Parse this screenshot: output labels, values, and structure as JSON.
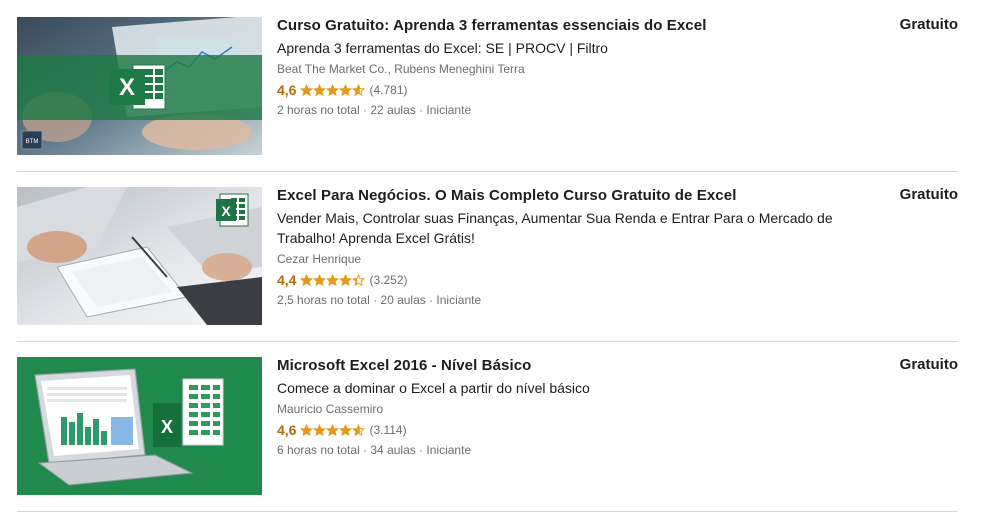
{
  "courses": [
    {
      "title": "Curso Gratuito: Aprenda 3 ferramentas essenciais do Excel",
      "headline": "Aprenda 3 ferramentas do Excel: SE | PROCV | Filtro",
      "instructor": "Beat The Market Co., Rubens Meneghini Terra",
      "rating": "4,6",
      "stars": 4.6,
      "rating_count": "(4.781)",
      "meta": "2 horas no total · 22 aulas · Iniciante",
      "price": "Gratuito",
      "thumb_badge": "BTM"
    },
    {
      "title": "Excel Para Negócios. O Mais Completo Curso Gratuito de Excel",
      "headline": "Vender Mais, Controlar suas Finanças, Aumentar Sua Renda e Entrar Para o Mercado de Trabalho! Aprenda Excel Grátis!",
      "instructor": "Cezar Henrique",
      "rating": "4,4",
      "stars": 4.4,
      "rating_count": "(3.252)",
      "meta": "2,5 horas no total · 20 aulas · Iniciante",
      "price": "Gratuito"
    },
    {
      "title": "Microsoft Excel 2016 - Nível Básico",
      "headline": "Comece a dominar o Excel a partir do nível básico",
      "instructor": "Mauricio Cassemiro",
      "rating": "4,6",
      "stars": 4.6,
      "rating_count": "(3.114)",
      "meta": "6 horas no total · 34 aulas · Iniciante",
      "price": "Gratuito"
    }
  ],
  "colors": {
    "rating": "#b4690e",
    "star": "#e59819",
    "excel_green": "#217346",
    "muted": "#6a6f73",
    "divider": "#d1d7dc"
  },
  "icons": {
    "star": "star-icon",
    "excel": "excel-logo-icon"
  }
}
